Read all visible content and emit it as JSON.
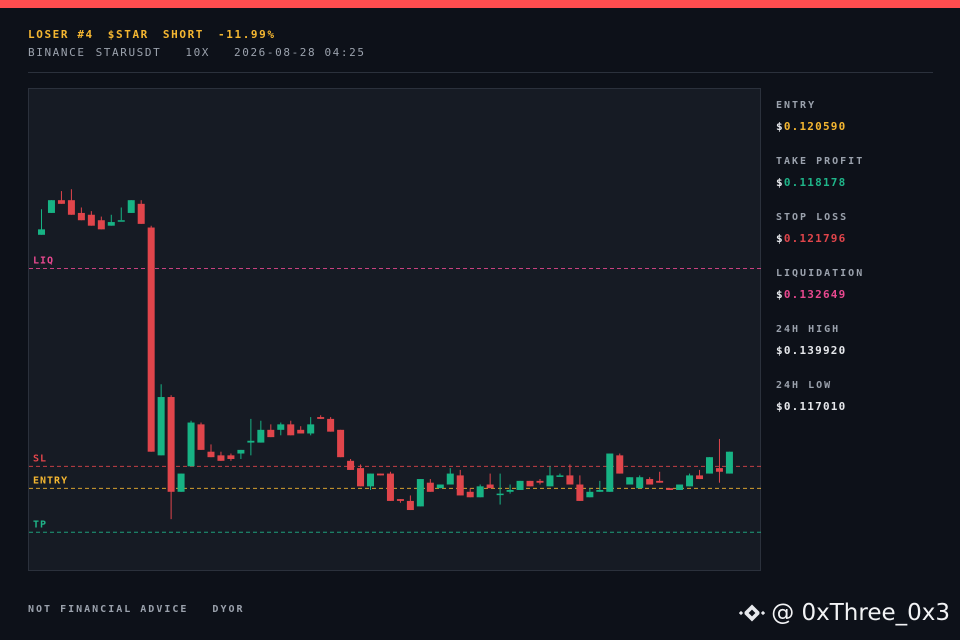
{
  "header": {
    "rank": "LOSER #4",
    "ticker": "$STAR",
    "side": "SHORT",
    "change": "-11.99%",
    "exchange": "BINANCE",
    "pair": "STARUSDT",
    "leverage": "10X",
    "timestamp": "2026-08-28 04:25"
  },
  "stats": [
    {
      "label": "ENTRY",
      "currency": "$",
      "value": "0.120590",
      "color": "#f5b731"
    },
    {
      "label": "TAKE PROFIT",
      "currency": "$",
      "value": "0.118178",
      "color": "#1fb589"
    },
    {
      "label": "STOP LOSS",
      "currency": "$",
      "value": "0.121796",
      "color": "#e0454b"
    },
    {
      "label": "LIQUIDATION",
      "currency": "$",
      "value": "0.132649",
      "color": "#e8488f"
    },
    {
      "label": "24H HIGH",
      "currency": "$",
      "value": "0.139920",
      "color": "#e6e8ec"
    },
    {
      "label": "24H LOW",
      "currency": "$",
      "value": "0.117010",
      "color": "#e6e8ec"
    }
  ],
  "footer": {
    "left": "NOT FINANCIAL ADVICE",
    "right": "DYOR"
  },
  "watermark": {
    "handle": "@ 0xThree_0x3",
    "icon": "binance-logo-icon"
  },
  "colors": {
    "up": "#17b384",
    "down": "#e0454b",
    "accent_bar": "#ff4d4f"
  },
  "chart_data": {
    "type": "candlestick",
    "ylim": [
      0.116,
      0.1425
    ],
    "levels": [
      {
        "name": "LIQ",
        "value": 0.132649,
        "color": "#e8488f"
      },
      {
        "name": "SL",
        "value": 0.121796,
        "color": "#e0454b"
      },
      {
        "name": "ENTRY",
        "value": 0.12059,
        "color": "#f5b731"
      },
      {
        "name": "TP",
        "value": 0.118178,
        "color": "#1fb589"
      }
    ],
    "candles": [
      [
        0.1345,
        0.1357,
        0.1348,
        0.1359
      ],
      [
        0.1357,
        0.1364,
        0.1364,
        0.1357
      ],
      [
        0.1364,
        0.1369,
        0.1362,
        0.1368
      ],
      [
        0.1364,
        0.1367,
        0.1356,
        0.137
      ],
      [
        0.1357,
        0.1359,
        0.1353,
        0.136
      ],
      [
        0.1356,
        0.1358,
        0.135,
        0.1358
      ],
      [
        0.1353,
        0.1355,
        0.1348,
        0.1355
      ],
      [
        0.135,
        0.1355,
        0.1352,
        0.1356
      ],
      [
        0.1353,
        0.136,
        0.1353,
        0.136
      ],
      [
        0.1357,
        0.1364,
        0.1364,
        0.1357
      ],
      [
        0.1362,
        0.1364,
        0.1351,
        0.1364
      ],
      [
        0.1349,
        0.135,
        0.1226,
        0.135
      ],
      [
        0.1224,
        0.1263,
        0.1256,
        0.1224
      ],
      [
        0.1256,
        0.1257,
        0.1204,
        0.1189
      ],
      [
        0.1204,
        0.1214,
        0.1214,
        0.1204
      ],
      [
        0.1218,
        0.1243,
        0.1242,
        0.1218
      ],
      [
        0.1241,
        0.1242,
        0.1227,
        0.1242
      ],
      [
        0.1226,
        0.123,
        0.1223,
        0.123
      ],
      [
        0.1224,
        0.1226,
        0.1221,
        0.1226
      ],
      [
        0.1224,
        0.1225,
        0.1222,
        0.1221
      ],
      [
        0.1225,
        0.1227,
        0.1227,
        0.1222
      ],
      [
        0.1231,
        0.1244,
        0.1232,
        0.1224
      ],
      [
        0.1231,
        0.1243,
        0.1238,
        0.1231
      ],
      [
        0.1238,
        0.1241,
        0.1234,
        0.1241
      ],
      [
        0.1238,
        0.1242,
        0.1241,
        0.1235
      ],
      [
        0.1241,
        0.1243,
        0.1235,
        0.1243
      ],
      [
        0.1238,
        0.124,
        0.1236,
        0.124
      ],
      [
        0.1236,
        0.1245,
        0.1241,
        0.1235
      ],
      [
        0.1245,
        0.1246,
        0.1244,
        0.1245
      ],
      [
        0.1244,
        0.1245,
        0.1237,
        0.1245
      ],
      [
        0.1238,
        0.1238,
        0.1223,
        0.1238
      ],
      [
        0.1221,
        0.1222,
        0.1216,
        0.1222
      ],
      [
        0.1217,
        0.1219,
        0.1207,
        0.1219
      ],
      [
        0.1207,
        0.1214,
        0.1214,
        0.1205
      ],
      [
        0.1214,
        0.1213,
        0.1213,
        0.1213
      ],
      [
        0.1214,
        0.1215,
        0.1199,
        0.1215
      ],
      [
        0.12,
        0.12,
        0.1199,
        0.1198
      ],
      [
        0.1199,
        0.12,
        0.1194,
        0.1202
      ],
      [
        0.1196,
        0.121,
        0.1211,
        0.1196
      ],
      [
        0.1209,
        0.1211,
        0.1204,
        0.1211
      ],
      [
        0.1206,
        0.1206,
        0.1208,
        0.1206
      ],
      [
        0.1208,
        0.1217,
        0.1214,
        0.1208
      ],
      [
        0.1213,
        0.1216,
        0.1202,
        0.1213
      ],
      [
        0.1204,
        0.1206,
        0.1201,
        0.1206
      ],
      [
        0.1201,
        0.1208,
        0.1207,
        0.1201
      ],
      [
        0.1208,
        0.1214,
        0.1206,
        0.1208
      ],
      [
        0.1203,
        0.1214,
        0.1203,
        0.1197
      ],
      [
        0.1204,
        0.1208,
        0.1205,
        0.1203
      ],
      [
        0.1205,
        0.121,
        0.121,
        0.1205
      ],
      [
        0.121,
        0.121,
        0.1207,
        0.1209
      ],
      [
        0.121,
        0.1211,
        0.1209,
        0.1208
      ],
      [
        0.1207,
        0.1218,
        0.1213,
        0.1207
      ],
      [
        0.1213,
        0.1214,
        0.1213,
        0.1213
      ],
      [
        0.1213,
        0.1219,
        0.1208,
        0.1213
      ],
      [
        0.1208,
        0.1213,
        0.1199,
        0.1213
      ],
      [
        0.1201,
        0.1206,
        0.1204,
        0.1201
      ],
      [
        0.1204,
        0.121,
        0.1205,
        0.1204
      ],
      [
        0.1204,
        0.1225,
        0.1225,
        0.1204
      ],
      [
        0.1224,
        0.1225,
        0.1214,
        0.1225
      ],
      [
        0.1208,
        0.1212,
        0.1212,
        0.1208
      ],
      [
        0.1206,
        0.1213,
        0.1212,
        0.1206
      ],
      [
        0.1211,
        0.1212,
        0.1208,
        0.1212
      ],
      [
        0.121,
        0.1215,
        0.1209,
        0.121
      ],
      [
        0.1206,
        0.1205,
        0.1205,
        0.1206
      ],
      [
        0.1205,
        0.1208,
        0.1208,
        0.1208
      ],
      [
        0.1207,
        0.1214,
        0.1213,
        0.1207
      ],
      [
        0.1213,
        0.1216,
        0.1211,
        0.1213
      ],
      [
        0.1214,
        0.1222,
        0.1223,
        0.1215
      ],
      [
        0.1217,
        0.1233,
        0.1215,
        0.1209
      ],
      [
        0.1214,
        0.1225,
        0.1226,
        0.1215
      ]
    ]
  }
}
